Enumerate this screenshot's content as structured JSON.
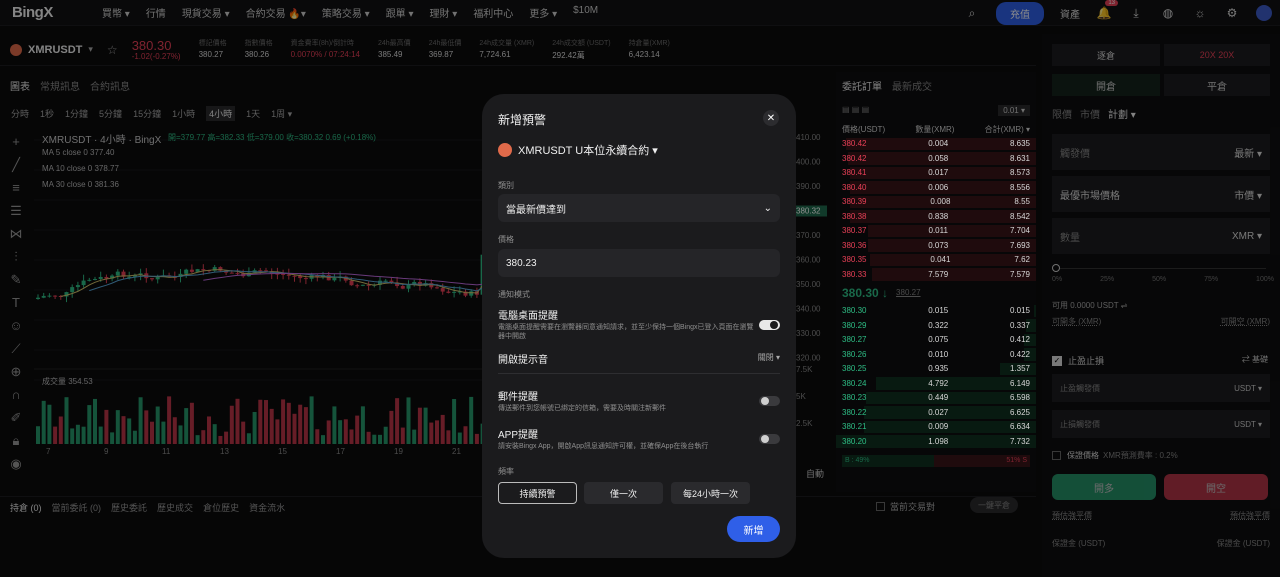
{
  "nav": {
    "logo": "BingX",
    "items": [
      "買幣 ▾",
      "行情",
      "現貨交易 ▾",
      "合約交易 🔥▾",
      "策略交易 ▾",
      "跟單 ▾",
      "理財 ▾",
      "福利中心",
      "更多 ▾",
      "$10M"
    ],
    "deposit": "充值",
    "assets": "資產",
    "notif_count": "13"
  },
  "ticker": {
    "symbol": "XMRUSDT",
    "price": "380.30",
    "change": "-1.02(-0.27%)",
    "stats": [
      {
        "label": "標記價格",
        "value": "380.27"
      },
      {
        "label": "指數價格",
        "value": "380.26"
      },
      {
        "label": "資金費率(8h)/倒計時",
        "value": "0.0070% / 07:24:14"
      },
      {
        "label": "24h最高價",
        "value": "385.49"
      },
      {
        "label": "24h最低價",
        "value": "369.87"
      },
      {
        "label": "24h成交量 (XMR)",
        "value": "7,724.61"
      },
      {
        "label": "24h成交額 (USDT)",
        "value": "292.42萬"
      },
      {
        "label": "持倉量(XMR)",
        "value": "6,423.14"
      }
    ]
  },
  "chart_tabs": [
    "圖表",
    "常規訊息",
    "合約訊息"
  ],
  "timeframes": [
    "分時",
    "1秒",
    "1分鐘",
    "5分鐘",
    "15分鐘",
    "1小時",
    "4小時",
    "1天",
    "1周 ▾"
  ],
  "chart": {
    "header": "XMRUSDT · 4小時 · BingX",
    "ohlc": "開=379.77 高=382.33 低=379.00 收=380.32 0.69 (+0.18%)",
    "ma5": "MA 5 close 0  377.40",
    "ma10": "MA 10 close 0  378.77",
    "ma30": "MA 30 close 0  381.36",
    "volume": "成交量  354.53",
    "y_ticks": [
      "410.00",
      "400.00",
      "390.00",
      "380.32",
      "370.00",
      "360.00",
      "350.00",
      "340.00",
      "330.00",
      "320.00",
      "7.5K",
      "5K",
      "2.5K"
    ],
    "x_ticks": [
      "7",
      "9",
      "11",
      "13",
      "15",
      "17",
      "19",
      "21"
    ],
    "auto": "自動"
  },
  "orderbook": {
    "tabs": [
      "委託訂單",
      "最新成交"
    ],
    "precision": "0.01 ▾",
    "headers": [
      "價格(USDT)",
      "數量(XMR)",
      "合計(XMR) ▾"
    ],
    "asks": [
      [
        "380.42",
        "0.004",
        "8.635",
        0.95
      ],
      [
        "380.42",
        "0.058",
        "8.631",
        0.94
      ],
      [
        "380.41",
        "0.017",
        "8.573",
        0.93
      ],
      [
        "380.40",
        "0.006",
        "8.556",
        0.93
      ],
      [
        "380.39",
        "0.008",
        "8.55",
        0.93
      ],
      [
        "380.38",
        "0.838",
        "8.542",
        0.93
      ],
      [
        "380.37",
        "0.011",
        "7.704",
        0.84
      ],
      [
        "380.36",
        "0.073",
        "7.693",
        0.84
      ],
      [
        "380.35",
        "0.041",
        "7.62",
        0.83
      ],
      [
        "380.33",
        "7.579",
        "7.579",
        0.82
      ]
    ],
    "last": "380.30 ↓",
    "mark": "380.27",
    "bids": [
      [
        "380.30",
        "0.015",
        "0.015",
        0.01
      ],
      [
        "380.29",
        "0.322",
        "0.337",
        0.05
      ],
      [
        "380.27",
        "0.075",
        "0.412",
        0.06
      ],
      [
        "380.26",
        "0.010",
        "0.422",
        0.06
      ],
      [
        "380.25",
        "0.935",
        "1.357",
        0.18
      ],
      [
        "380.24",
        "4.792",
        "6.149",
        0.8
      ],
      [
        "380.23",
        "0.449",
        "6.598",
        0.85
      ],
      [
        "380.22",
        "0.027",
        "6.625",
        0.86
      ],
      [
        "380.21",
        "0.009",
        "6.634",
        0.86
      ],
      [
        "380.20",
        "1.098",
        "7.732",
        1.0
      ]
    ],
    "buy_pct": "B : 49%",
    "sell_pct": "51% S"
  },
  "bottom_tabs": [
    "持倉 (0)",
    "當前委託 (0)",
    "歷史委託",
    "歷史成交",
    "倉位歷史",
    "資金流水"
  ],
  "bottom_right": {
    "filter": "當前交易對",
    "close_all": "一鍵平倉"
  },
  "right_panel": {
    "mode": "逐倉",
    "leverage": "20X  20X",
    "open": "開倉",
    "close": "平倉",
    "types": [
      "限價",
      "市價",
      "計劃 ▾"
    ],
    "trigger": "觸發價",
    "trigger_sel": "最新 ▾",
    "best": "最優市場價格",
    "best_sel": "市價 ▾",
    "qty": "數量",
    "qty_unit": "XMR ▾",
    "pcts": [
      "0%",
      "25%",
      "50%",
      "75%",
      "100%"
    ],
    "avail": "可用 0.0000 USDT ⇌",
    "can_long": "可開多 (XMR)",
    "can_short": "可開空 (XMR)",
    "tpsl": "止盈止損",
    "basic": "⇄ 基礎",
    "tp": "止盈觸發價",
    "sl": "止損觸發價",
    "unit": "USDT ▾",
    "guarantee": "保證價格",
    "guarantee_fee": "XMR預測費率 : 0.2%",
    "long": "開多",
    "short": "開空",
    "est_liq": "預估強平價",
    "est_liq2": "預估強平價",
    "margin": "保證金 (USDT)",
    "margin2": "保證金 (USDT)"
  },
  "modal": {
    "title": "新增預警",
    "symbol": "XMRUSDT U本位永續合約 ▾",
    "type_label": "類別",
    "type_value": "當最新價達到",
    "price_label": "價格",
    "price_value": "380.23",
    "notify_label": "通知模式",
    "desktop": "電腦桌面提醒",
    "desktop_desc": "電腦桌面提醒需要在瀏覽器同意通知請求，並至少保持一個Bingx已登入頁面在瀏覽器中開啟",
    "sound": "開啟提示音",
    "sound_value": "關閉 ▾",
    "email": "郵件提醒",
    "email_desc": "傳送郵件到您帳號已綁定的信箱，需要及時關注新郵件",
    "app": "APP提醒",
    "app_desc": "請安裝Bingx App，開啟App訊息通知許可權，並確保App在後台執行",
    "freq_label": "頻率",
    "freq": [
      "持續預警",
      "僅一次",
      "每24小時一次"
    ],
    "submit": "新增"
  }
}
